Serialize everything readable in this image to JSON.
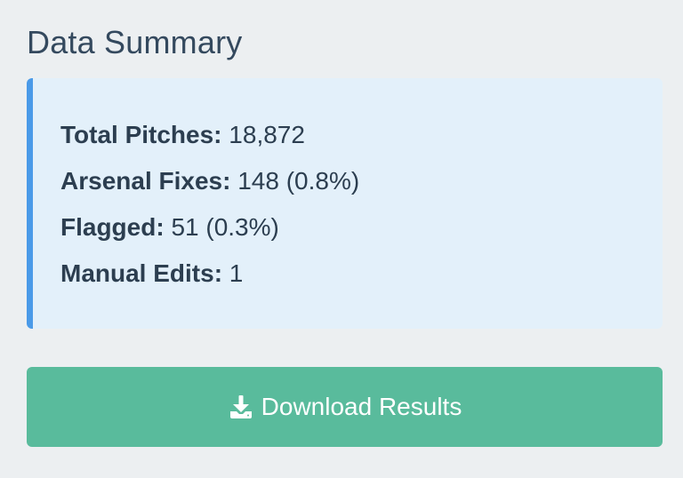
{
  "header": {
    "title": "Data Summary"
  },
  "summary": {
    "items": [
      {
        "label": "Total Pitches:",
        "value": "18,872"
      },
      {
        "label": "Arsenal Fixes:",
        "value": "148 (0.8%)"
      },
      {
        "label": "Flagged:",
        "value": "51 (0.3%)"
      },
      {
        "label": "Manual Edits:",
        "value": "1"
      }
    ]
  },
  "actions": {
    "download_label": "Download Results",
    "download_icon": "download-icon"
  },
  "colors": {
    "background": "#eceff1",
    "summary_bg": "#e3f0fa",
    "accent_border": "#4a9ae8",
    "button": "#59bb9c",
    "text": "#2c3e50"
  }
}
